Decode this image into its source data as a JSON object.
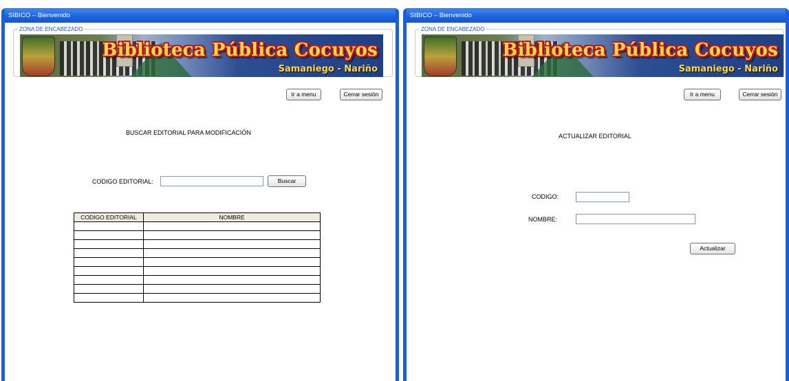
{
  "left_window": {
    "title": "SIBICO – Bienvenido",
    "header_zone_label": "ZONA DE ENCABEZADO",
    "banner_title": "Biblioteca Pública Cocuyos",
    "banner_subtitle": "Samaniego - Nariño",
    "menu_button": "Ir a menu",
    "logout_button": "Cerrar sesión",
    "heading": "BUSCAR EDITORIAL  PARA MODIFICACIÓN",
    "code_label": "CODIGO EDITORIAL:",
    "code_value": "",
    "search_button": "Buscar",
    "table": {
      "columns": [
        "CODIGO EDITORIAL",
        "NOMBRE"
      ],
      "rows": [
        [
          "",
          ""
        ],
        [
          "",
          ""
        ],
        [
          "",
          ""
        ],
        [
          "",
          ""
        ],
        [
          "",
          ""
        ],
        [
          "",
          ""
        ],
        [
          "",
          ""
        ],
        [
          "",
          ""
        ],
        [
          "",
          ""
        ]
      ]
    }
  },
  "right_window": {
    "title": "SIBICO – Bienvenido",
    "header_zone_label": "ZONA DE ENCABEZADO",
    "banner_title": "Biblioteca Pública Cocuyos",
    "banner_subtitle": "Samaniego - Nariño",
    "menu_button": "Ir a menu",
    "logout_button": "Cerrar sesión",
    "heading": "ACTUALIZAR EDITORIAL",
    "code_label": "CODIGO:",
    "code_value": "",
    "name_label": "NOMBRE:",
    "name_value": "",
    "update_button": "Actualizar"
  }
}
